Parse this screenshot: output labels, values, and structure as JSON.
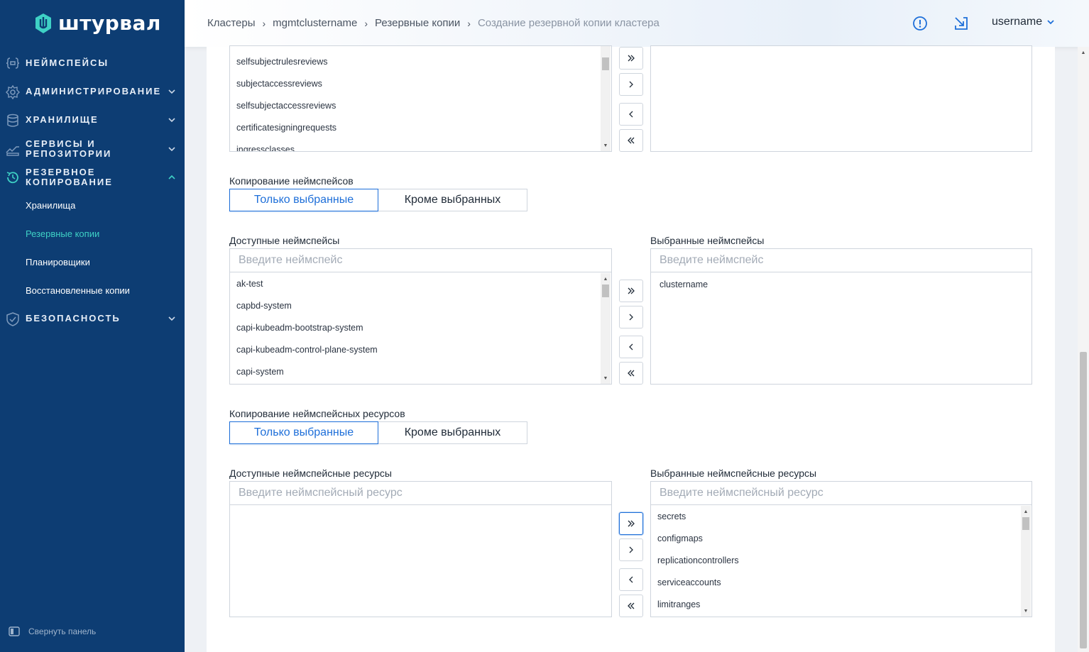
{
  "brand": {
    "name": "штурвал"
  },
  "sidebar": {
    "items": [
      {
        "label": "Неймспейсы",
        "icon": "braces-icon"
      },
      {
        "label": "Администрирование",
        "icon": "gear-icon"
      },
      {
        "label": "Хранилище",
        "icon": "database-icon"
      },
      {
        "label": "Сервисы и репозитории",
        "icon": "services-icon"
      },
      {
        "label": "Резервное копирование",
        "icon": "backup-icon"
      },
      {
        "label": "Безопасность",
        "icon": "shield-icon"
      }
    ],
    "subitems": [
      "Хранилища",
      "Резервные копии",
      "Планировщики",
      "Восстановленные копии"
    ],
    "collapse_label": "Свернуть панель"
  },
  "header": {
    "breadcrumbs": [
      "Кластеры",
      "mgmtclustername",
      "Резервные копии",
      "Создание резервной копии кластера"
    ],
    "username": "username"
  },
  "top_list": {
    "items": [
      "selfsubjectrulesreviews",
      "subjectaccessreviews",
      "selfsubjectaccessreviews",
      "certificatesigningrequests",
      "ingressclasses"
    ]
  },
  "ns_copy": {
    "label": "Копирование неймспейсов",
    "options": [
      "Только выбранные",
      "Кроме выбранных"
    ],
    "selected": "Только выбранные"
  },
  "ns_available": {
    "label": "Доступные неймспейсы",
    "placeholder": "Введите неймспейс",
    "items": [
      "ak-test",
      "capbd-system",
      "capi-kubeadm-bootstrap-system",
      "capi-kubeadm-control-plane-system",
      "capi-system"
    ]
  },
  "ns_selected": {
    "label": "Выбранные неймспейсы",
    "placeholder": "Введите неймспейс",
    "items": [
      "clustername"
    ]
  },
  "res_copy": {
    "label": "Копирование неймспейсных ресурсов",
    "options": [
      "Только выбранные",
      "Кроме выбранных"
    ],
    "selected": "Только выбранные"
  },
  "res_available": {
    "label": "Доступные неймспейсные ресурсы",
    "placeholder": "Введите неймспейсный ресурс",
    "items": []
  },
  "res_selected": {
    "label": "Выбранные неймспейсные ресурсы",
    "placeholder": "Введите неймспейсный ресурс",
    "items": [
      "secrets",
      "configmaps",
      "replicationcontrollers",
      "serviceaccounts",
      "limitranges"
    ]
  },
  "colors": {
    "sidebar": "#0d3d73",
    "accent": "#1e6fd9",
    "active_sub": "#3ed1c5"
  }
}
